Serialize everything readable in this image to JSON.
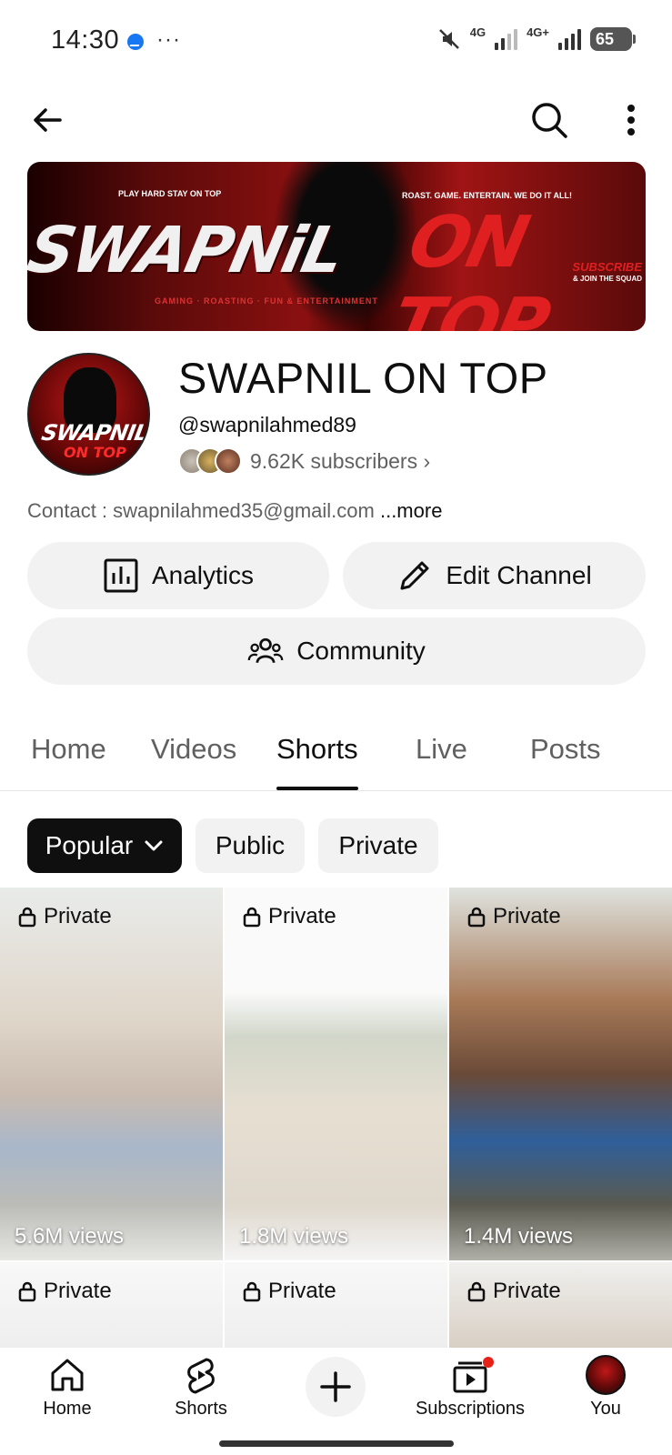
{
  "status_bar": {
    "time": "14:30",
    "network_1": "4G",
    "network_2": "4G+",
    "battery": "65"
  },
  "banner": {
    "title_left": "SWAPNiL",
    "title_right": "ON TOP",
    "tagline_left": "PLAY HARD STAY ON TOP",
    "tagline_right": "ROAST. GAME. ENTERTAIN. WE DO IT ALL!",
    "subscribe": "SUBSCRIBE",
    "subscribe_sub": "& JOIN THE SQUAD",
    "strip": "GAMING  ·  ROASTING  ·  FUN & ENTERTAINMENT"
  },
  "channel": {
    "avatar_text_1": "SWAPNIL",
    "avatar_text_2": "ON TOP",
    "name": "SWAPNIL ON TOP",
    "handle": "@swapnilahmed89",
    "subscribers": "9.62K subscribers ›",
    "contact": "Contact : swapnilahmed35@gmail.com ",
    "more": "...more"
  },
  "actions": {
    "analytics": "Analytics",
    "edit_channel": "Edit Channel",
    "community": "Community"
  },
  "tabs": [
    "Home",
    "Videos",
    "Shorts",
    "Live",
    "Posts"
  ],
  "active_tab": "Shorts",
  "filters": {
    "popular": "Popular",
    "public": "Public",
    "private": "Private"
  },
  "shorts": [
    {
      "badge": "Private",
      "views": "5.6M views"
    },
    {
      "badge": "Private",
      "views": "1.8M views"
    },
    {
      "badge": "Private",
      "views": "1.4M views"
    },
    {
      "badge": "Private",
      "views": ""
    },
    {
      "badge": "Private",
      "views": ""
    },
    {
      "badge": "Private",
      "views": ""
    }
  ],
  "bottom_nav": {
    "home": "Home",
    "shorts": "Shorts",
    "subscriptions": "Subscriptions",
    "you": "You"
  },
  "colors": {
    "chip_selected": "#0f0f0f",
    "button_bg": "#f2f2f2",
    "notification_dot": "#e62117",
    "banner_red": "#e02020"
  }
}
